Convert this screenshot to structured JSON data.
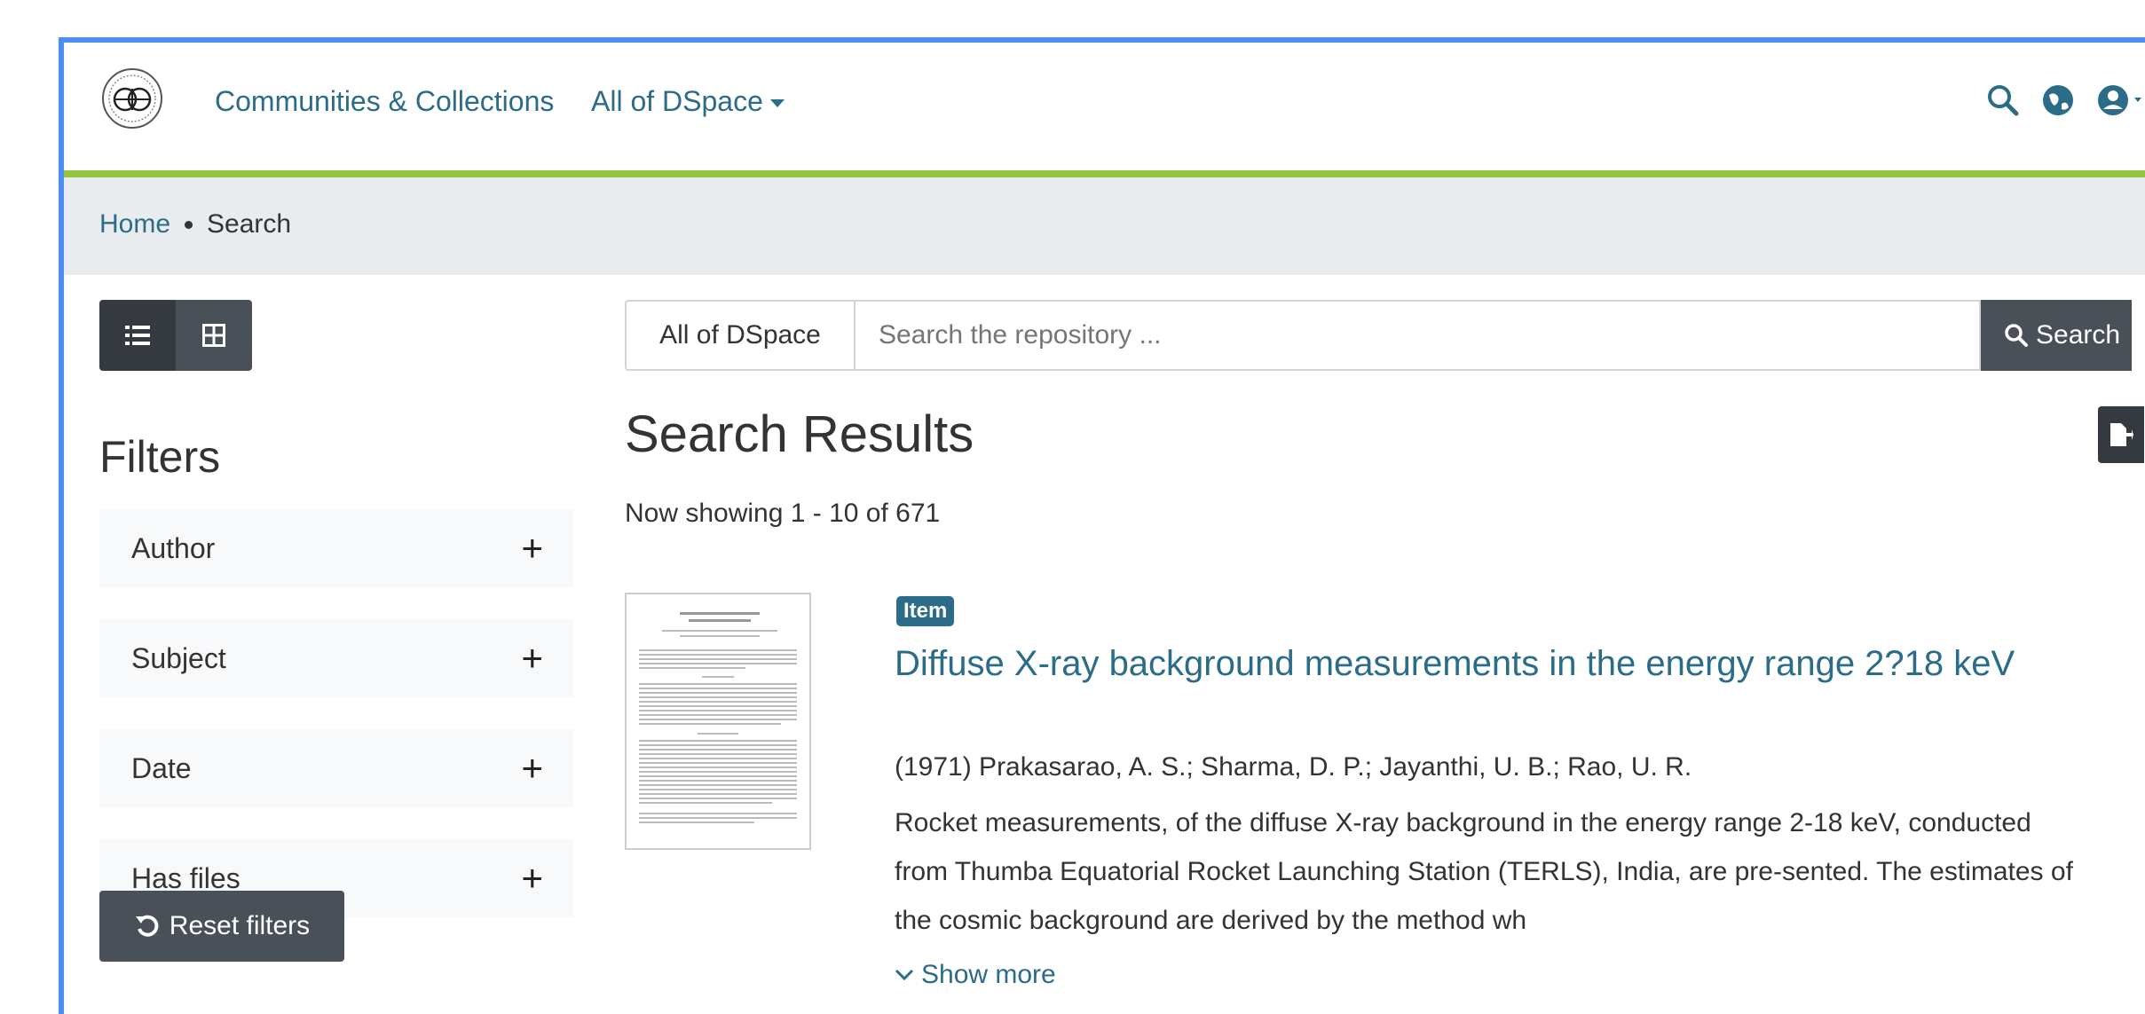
{
  "navbar": {
    "logo_icon": "institute-seal-logo",
    "communities_label": "Communities & Collections",
    "all_dspace_label": "All of DSpace",
    "icons": [
      "search-icon",
      "language-globe-icon",
      "user-account-icon"
    ]
  },
  "breadcrumb": {
    "home": "Home",
    "current": "Search"
  },
  "view_toggle": {
    "list_icon": "list-view-icon",
    "grid_icon": "grid-view-icon"
  },
  "filters": {
    "title": "Filters",
    "items": [
      {
        "label": "Author",
        "toggle": "+"
      },
      {
        "label": "Subject",
        "toggle": "+"
      },
      {
        "label": "Date",
        "toggle": "+"
      },
      {
        "label": "Has files",
        "toggle": "+"
      }
    ],
    "reset_label": "Reset filters"
  },
  "search": {
    "scope_label": "All of DSpace",
    "placeholder": "Search the repository ...",
    "button_label": "Search"
  },
  "results": {
    "title": "Search Results",
    "showing": "Now showing 1 - 10 of 671",
    "items": [
      {
        "badge": "Item",
        "title": "Diffuse X-ray background measurements in the energy range 2?18 keV",
        "meta": "(1971) Prakasarao, A. S.; Sharma, D. P.; Jayanthi, U. B.; Rao, U. R.",
        "abstract": "Rocket measurements, of the diffuse X-ray background in the energy range 2-18 keV, conducted from Thumba Equatorial Rocket Launching Station (TERLS), India, are pre-sented. The estimates of the cosmic background are derived by the method wh",
        "show_more": "Show more"
      }
    ]
  },
  "colors": {
    "link": "#2b6c88",
    "accent_bar": "#92c642",
    "frame": "#4b8ff0",
    "dark_button": "#495057"
  }
}
